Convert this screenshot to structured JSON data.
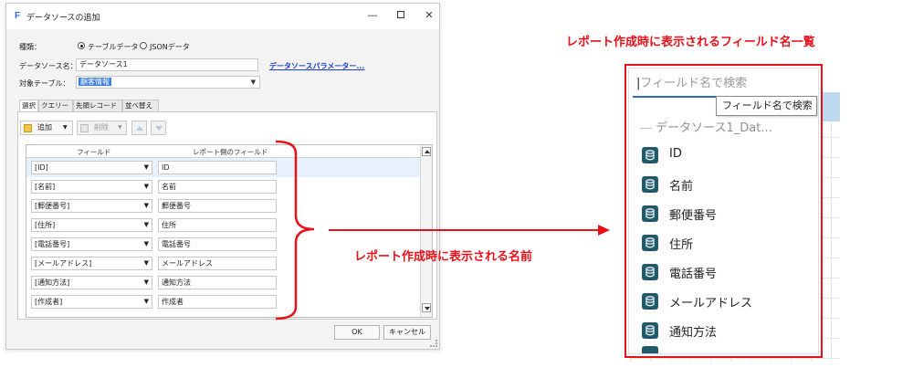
{
  "dialog": {
    "app_icon": "F",
    "title": "データソースの追加",
    "controls": {
      "minimize": "—",
      "maximize": "",
      "close": "✕"
    },
    "kind_label": "種類：",
    "radio_table": "テーブルデータ",
    "radio_json": "JSONデータ",
    "name_label": "データソース名：",
    "name_value": "データソース1",
    "param_link": "データソースパラメーター...",
    "table_label": "対象テーブル：",
    "table_value": "顧客情報",
    "tabs": [
      "選択",
      "クエリー",
      "先頭レコード",
      "並べ替え"
    ],
    "toolbar": {
      "add": "追加",
      "delete": "削除"
    },
    "grid_headers": {
      "field": "フィールド",
      "report_field": "レポート側のフィールド"
    },
    "rows": [
      {
        "field": "[ID]",
        "report": "ID"
      },
      {
        "field": "[名前]",
        "report": "名前"
      },
      {
        "field": "[郵便番号]",
        "report": "郵便番号"
      },
      {
        "field": "[住所]",
        "report": "住所"
      },
      {
        "field": "[電話番号]",
        "report": "電話番号"
      },
      {
        "field": "[メールアドレス]",
        "report": "メールアドレス"
      },
      {
        "field": "[通知方法]",
        "report": "通知方法"
      },
      {
        "field": "[作成者]",
        "report": "作成者"
      }
    ],
    "ok": "OK",
    "cancel": "キャンセル"
  },
  "annotations": {
    "top": "レポート作成時に表示されるフィールド名一覧",
    "middle": "レポート作成時に表示される名前",
    "accent_color": "#e8111a"
  },
  "field_list": {
    "search_placeholder": "フィールド名で検索",
    "tooltip": "フィールド名で検索",
    "group": "データソース1_Dat...",
    "items": [
      "ID",
      "名前",
      "郵便番号",
      "住所",
      "電話番号",
      "メールアドレス",
      "通知方法"
    ],
    "item_icon": "database-icon"
  }
}
